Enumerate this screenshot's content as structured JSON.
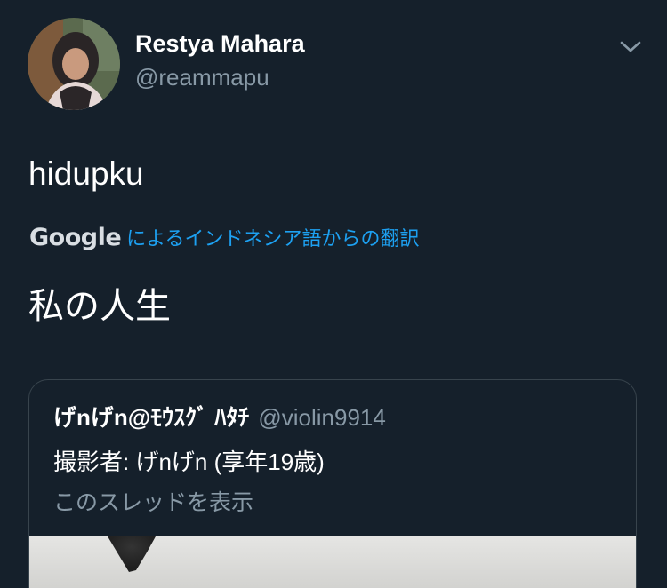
{
  "tweet": {
    "author": {
      "display_name": "Restya Mahara",
      "handle": "@reammapu"
    },
    "text": "hidupku",
    "translation": {
      "provider": "Google",
      "label": "によるインドネシア語からの翻訳",
      "text": "私の人生"
    },
    "quoted": {
      "display_name": "げnげn@ﾓｳｽｸﾞ ﾊﾀﾁ",
      "handle": "@violin9914",
      "text": "撮影者: げnげn (享年19歳)",
      "show_thread": "このスレッドを表示"
    }
  },
  "colors": {
    "background": "#15202b",
    "primary_text": "#ffffff",
    "secondary_text": "#8899a6",
    "link": "#1da1f2",
    "border": "#38444d"
  },
  "icons": {
    "menu": "chevron-down-icon"
  }
}
